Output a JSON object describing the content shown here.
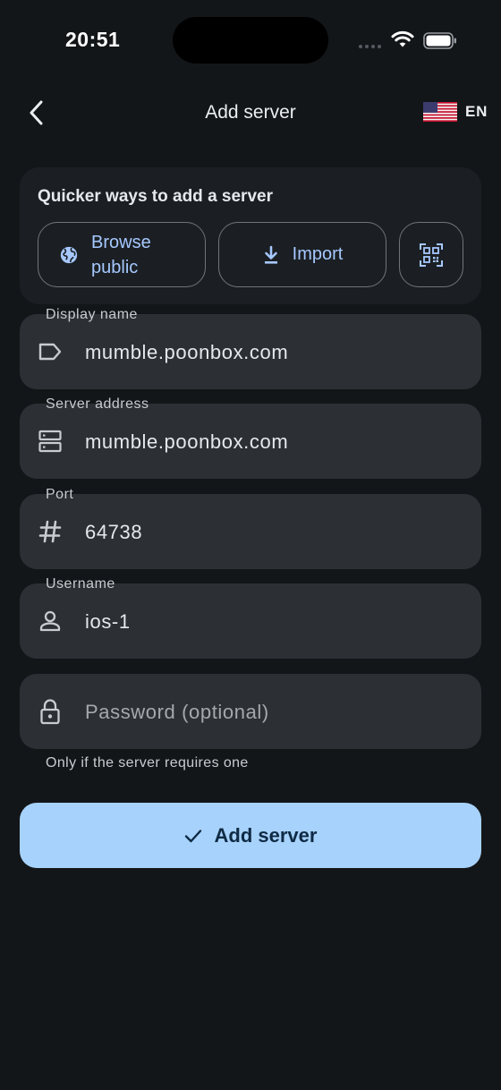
{
  "status_bar": {
    "time": "20:51"
  },
  "header": {
    "title": "Add server",
    "language_code": "EN",
    "back_icon": "chevron-left-icon",
    "flag_icon": "us-flag-icon"
  },
  "quick": {
    "title": "Quicker ways to add a server",
    "browse_label": "Browse public",
    "import_label": "Import",
    "accent": "#a6c8ff"
  },
  "fields": {
    "display_name": {
      "label": "Display name",
      "value": "mumble.poonbox.com",
      "icon": "label-tag-icon"
    },
    "server_address": {
      "label": "Server address",
      "value": "mumble.poonbox.com",
      "icon": "server-icon"
    },
    "port": {
      "label": "Port",
      "value": "64738",
      "icon": "hash-icon"
    },
    "username": {
      "label": "Username",
      "value": "ios-1",
      "icon": "person-icon"
    },
    "password": {
      "placeholder": "Password (optional)",
      "helper": "Only if the server requires one",
      "icon": "lock-icon"
    }
  },
  "primary_button": {
    "label": "Add server",
    "icon": "check-icon",
    "color": "#a7d2fb"
  }
}
